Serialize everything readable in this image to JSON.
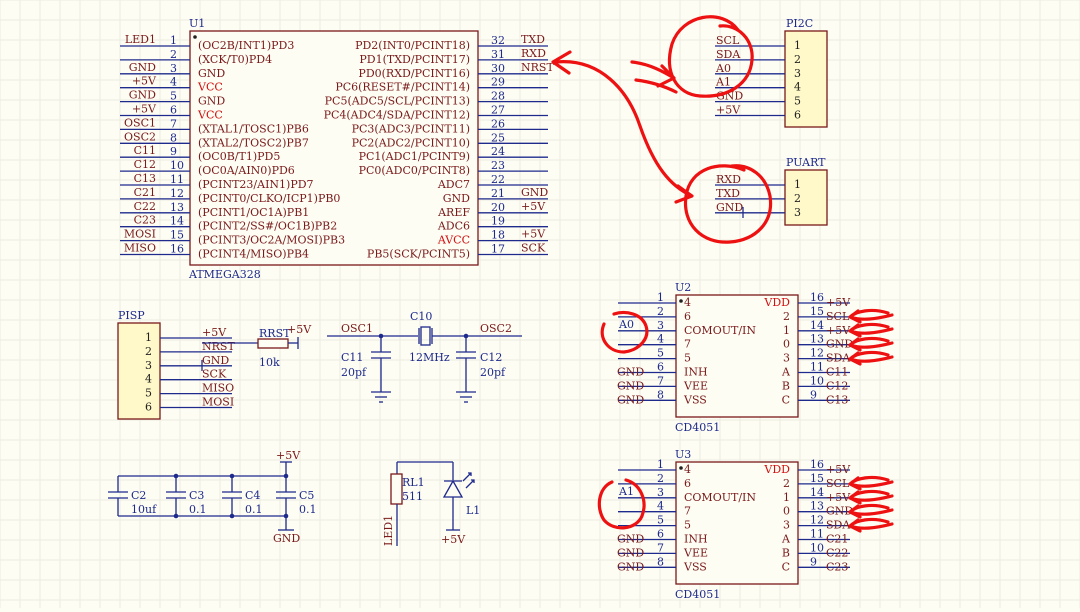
{
  "u1": {
    "ref": "U1",
    "part": "ATMEGA328",
    "left_nets": [
      "LED1",
      "",
      "",
      "GND",
      "+5V",
      "GND",
      "+5V",
      "OSC1",
      "OSC2",
      "C11",
      "C12",
      "C13",
      "C21",
      "C22",
      "C23",
      "MOSI",
      "MISO"
    ],
    "left_nums": [
      "1",
      "2",
      "3",
      "4",
      "5",
      "6",
      "7",
      "8",
      "9",
      "10",
      "11",
      "12",
      "13",
      "14",
      "15",
      "16"
    ],
    "left_names": [
      "(OC2B/INT1)PD3",
      "(XCK/T0)PD4",
      "GND",
      "VCC",
      "GND",
      "VCC",
      "(XTAL1/TOSC1)PB6",
      "(XTAL2/TOSC2)PB7",
      "(OC0B/T1)PD5",
      "(OC0A/AIN0)PD6",
      "(PCINT23/AIN1)PD7",
      "(PCINT0/CLKO/ICP1)PB0",
      "(PCINT1/OC1A)PB1",
      "(PCINT2/SS#/OC1B)PB2",
      "(PCINT3/OC2A/MOSI)PB3",
      "(PCINT4/MISO)PB4"
    ],
    "right_names": [
      "PD2(INT0/PCINT18)",
      "PD1(TXD/PCINT17)",
      "PD0(RXD/PCINT16)",
      "PC6(RESET#/PCINT14)",
      "PC5(ADC5/SCL/PCINT13)",
      "PC4(ADC4/SDA/PCINT12)",
      "PC3(ADC3/PCINT11)",
      "PC2(ADC2/PCINT10)",
      "PC1(ADC1/PCINT9)",
      "PC0(ADC0/PCINT8)",
      "ADC7",
      "GND",
      "AREF",
      "ADC6",
      "AVCC",
      "PB5(SCK/PCINT5)"
    ],
    "right_nums": [
      "32",
      "31",
      "30",
      "29",
      "28",
      "27",
      "26",
      "25",
      "24",
      "23",
      "22",
      "21",
      "20",
      "19",
      "18",
      "17"
    ],
    "right_nets": [
      "",
      "TXD",
      "RXD",
      "NRST",
      "",
      "",
      "",
      "",
      "",
      "",
      "",
      "",
      "GND",
      "+5V",
      "",
      "+5V",
      "SCK"
    ]
  },
  "pi2c": {
    "ref": "PI2C",
    "nets": [
      "SCL",
      "SDA",
      "A0",
      "A1",
      "GND",
      "+5V"
    ],
    "pins": [
      "1",
      "2",
      "3",
      "4",
      "5",
      "6"
    ]
  },
  "puart": {
    "ref": "PUART",
    "nets": [
      "RXD",
      "TXD",
      "GND"
    ],
    "pins": [
      "1",
      "2",
      "3"
    ]
  },
  "pisp": {
    "ref": "PISP",
    "pins": [
      "1",
      "2",
      "3",
      "4",
      "5",
      "6"
    ],
    "nets": [
      "+5V",
      "NRST",
      "GND",
      "SCK",
      "MISO",
      "MOSI"
    ],
    "res_ref": "RRST",
    "res_val": "10k",
    "res_net": "+5V"
  },
  "xtal": {
    "osc1": "OSC1",
    "osc2": "OSC2",
    "ref": "C10",
    "freq": "12MHz",
    "c1_ref": "C11",
    "c1_val": "20pf",
    "c2_ref": "C12",
    "c2_val": "20pf"
  },
  "mux_u2": {
    "ref": "U2",
    "part": "CD4051",
    "ctrl_net": "A0",
    "left_nums": [
      "1",
      "2",
      "3",
      "4",
      "5",
      "6",
      "7",
      "8"
    ],
    "left_names": [
      "4",
      "6",
      "COMOUT/IN",
      "7",
      "5",
      "INH",
      "VEE",
      "VSS"
    ],
    "left_nets": [
      "",
      "",
      "A0",
      "",
      "",
      "GND",
      "GND",
      "GND"
    ],
    "right_names": [
      "VDD",
      "2",
      "1",
      "0",
      "3",
      "A",
      "B",
      "C"
    ],
    "right_nums": [
      "16",
      "15",
      "14",
      "13",
      "12",
      "11",
      "10",
      "9"
    ],
    "right_nets": [
      "+5V",
      "SCL",
      "+5V",
      "GND",
      "SDA",
      "C11",
      "C12",
      "C13"
    ]
  },
  "mux_u3": {
    "ref": "U3",
    "part": "CD4051",
    "ctrl_net": "A1",
    "left_nums": [
      "1",
      "2",
      "3",
      "4",
      "5",
      "6",
      "7",
      "8"
    ],
    "left_names": [
      "4",
      "6",
      "COMOUT/IN",
      "7",
      "5",
      "INH",
      "VEE",
      "VSS"
    ],
    "left_nets": [
      "",
      "",
      "A1",
      "",
      "",
      "GND",
      "GND",
      "GND"
    ],
    "right_names": [
      "VDD",
      "2",
      "1",
      "0",
      "3",
      "A",
      "B",
      "C"
    ],
    "right_nums": [
      "16",
      "15",
      "14",
      "13",
      "12",
      "11",
      "10",
      "9"
    ],
    "right_nets": [
      "+5V",
      "SCL",
      "+5V",
      "GND",
      "SDA",
      "C21",
      "C22",
      "C23"
    ]
  },
  "decoupling": {
    "top_net": "+5V",
    "bottom_net": "GND",
    "caps": [
      {
        "ref": "C2",
        "val": "10uf"
      },
      {
        "ref": "C3",
        "val": "0.1"
      },
      {
        "ref": "C4",
        "val": "0.1"
      },
      {
        "ref": "C5",
        "val": "0.1"
      }
    ]
  },
  "led": {
    "res_ref": "RL1",
    "res_val": "511",
    "led_ref": "L1",
    "net_in": "LED1",
    "net_pwr": "+5V"
  },
  "colors": {
    "wire": "#1e2a8c",
    "body": "#7a1a1a",
    "header": "#fff8c8",
    "annotation": "#ee1111",
    "power_pin": "#d41010"
  }
}
